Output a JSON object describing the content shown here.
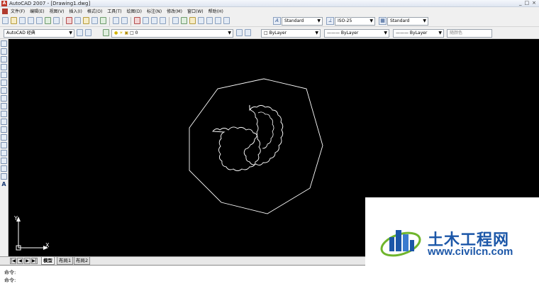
{
  "window": {
    "title": "AutoCAD 2007 - [Drawing1.dwg]",
    "app_icon_text": "A",
    "controls": [
      "_",
      "□",
      "×"
    ]
  },
  "menu": {
    "items": [
      "文件(F)",
      "编辑(E)",
      "视图(V)",
      "插入(I)",
      "格式(O)",
      "工具(T)",
      "绘图(D)",
      "标注(N)",
      "修改(M)",
      "窗口(W)",
      "帮助(H)"
    ]
  },
  "styles": {
    "text_style_icon": "A",
    "text_style": "Standard",
    "dim_style": "ISO-25",
    "table_style": "Standard"
  },
  "workspace": {
    "value": "AutoCAD 经典"
  },
  "layers": {
    "current": "0"
  },
  "properties": {
    "color": "ByLayer",
    "linetype": "ByLayer",
    "lineweight": "ByLayer",
    "plot_style": "随颜色"
  },
  "left_tools": [
    "line-tool-icon",
    "xline-tool-icon",
    "polyline-tool-icon",
    "polygon-tool-icon",
    "rectangle-tool-icon",
    "arc-tool-icon",
    "circle-tool-icon",
    "revcloud-tool-icon",
    "spline-tool-icon",
    "ellipse-tool-icon",
    "ellipse-arc-tool-icon",
    "insert-block-icon",
    "make-block-icon",
    "point-tool-icon",
    "hatch-tool-icon",
    "gradient-tool-icon",
    "region-tool-icon",
    "table-tool-icon",
    "mtext-tool-icon"
  ],
  "mtext_glyph": "A",
  "ucs": {
    "x_label": "X",
    "y_label": "Y"
  },
  "layout_tabs": {
    "model": "模型",
    "layout1": "布局1",
    "layout2": "布局2"
  },
  "nav_buttons": [
    "|◀",
    "◀",
    "▶",
    "▶|"
  ],
  "command": {
    "line1": "命令:",
    "line2": "命令:"
  },
  "watermark": {
    "title": "土木工程网",
    "url": "www.civilcn.com"
  },
  "colors": {
    "canvas": "#000000",
    "drawing_stroke": "#ffffff",
    "watermark_blue": "#1c57a8",
    "watermark_green": "#6fb52c"
  }
}
